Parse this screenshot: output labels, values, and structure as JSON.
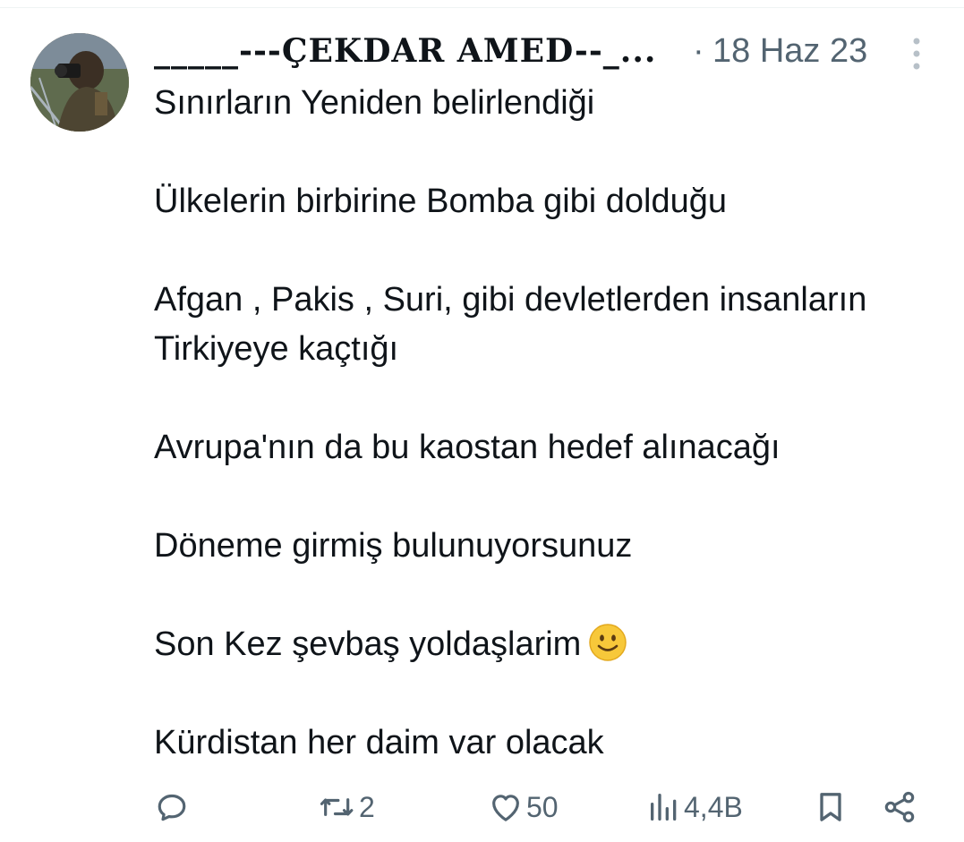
{
  "tweet": {
    "author_name": "_____---ÇEKDAR AMED--_...",
    "separator": "·",
    "date": "18 Haz 23",
    "text_lines": [
      "Sınırların Yeniden belirlendiği",
      "",
      "Ülkelerin birbirine Bomba gibi dolduğu",
      "",
      "Afgan , Pakis , Suri, gibi devletlerden insanların",
      "Tirkiyeye kaçtığı",
      "",
      "Avrupa'nın da bu kaostan hedef alınacağı",
      "",
      "Döneme girmiş bulunuyorsunuz",
      "",
      "Son Kez şevbaş yoldaşlarim",
      "",
      "Kürdistan her daim var olacak"
    ]
  },
  "actions": {
    "reply": {
      "icon": "reply-icon"
    },
    "retweet": {
      "icon": "retweet-icon",
      "count": "2"
    },
    "like": {
      "icon": "heart-icon",
      "count": "50"
    },
    "views": {
      "icon": "views-icon",
      "count": "4,4B"
    },
    "bookmark": {
      "icon": "bookmark-icon"
    },
    "share": {
      "icon": "share-icon"
    }
  },
  "colors": {
    "text": "#0f1419",
    "secondary": "#536471",
    "divider": "#eff3f4",
    "emoji": "#f7c83a"
  }
}
